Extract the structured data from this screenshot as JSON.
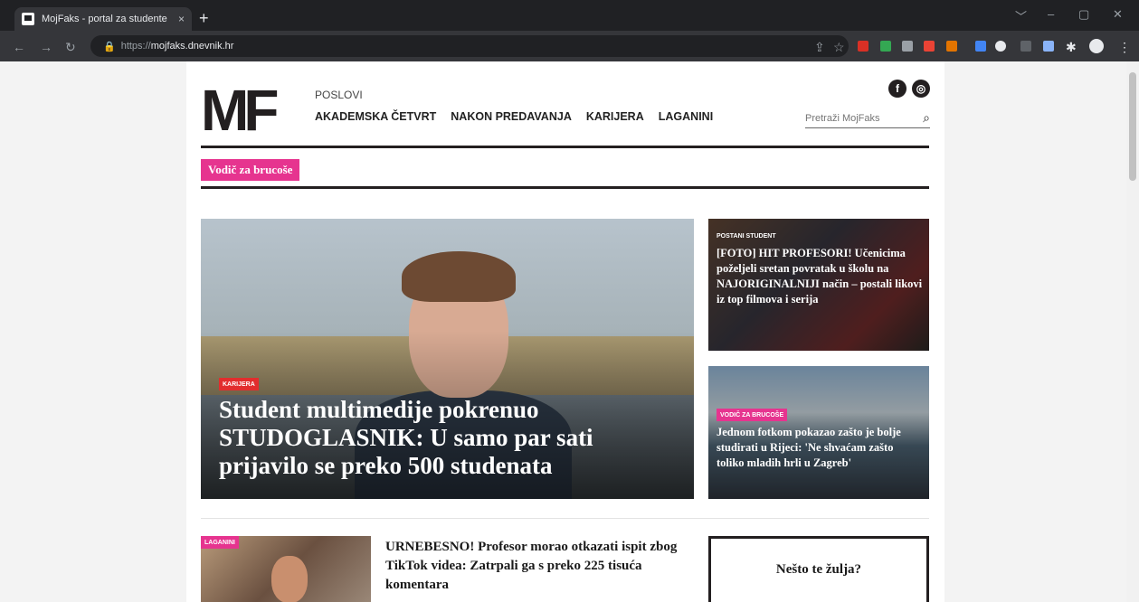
{
  "browser": {
    "tab_title": "MojFaks - portal za studente",
    "tab_close": "×",
    "new_tab": "+",
    "url_scheme": "https://",
    "url_host": "mojfaks.dnevnik.hr",
    "window_controls": [
      "﹀",
      "–",
      "▢",
      "✕"
    ]
  },
  "site": {
    "logo": "MF",
    "nav_top": "POSLOVI",
    "nav_main": [
      "AKADEMSKA ČETVRT",
      "NAKON PREDAVANJA",
      "KARIJERA",
      "LAGANINI"
    ],
    "social": [
      "f",
      "◎"
    ],
    "search_placeholder": "Pretraži MojFaks",
    "pill": "Vodič za brucoše"
  },
  "hero": {
    "tag": "KARIJERA",
    "title": "Student multimedije pokrenuo STUDOGLASNIK: U samo par sati prijavilo se preko 500 studenata"
  },
  "side_cards": [
    {
      "tag": "POSTANI STUDENT",
      "title": "[FOTO] HIT PROFESORI! Učenicima poželjeli sretan povratak u školu na NAJORIGINALNIJI način – postali likovi iz top filmova i serija"
    },
    {
      "tag": "VODIČ ZA BRUCOŠE",
      "title": "Jednom fotkom pokazao zašto je bolje studirati u Rijeci: 'Ne shvaćam zašto toliko mladih hrli u Zagreb'"
    }
  ],
  "article": {
    "tag": "LAGANINI",
    "title": "URNEBESNO! Profesor morao otkazati ispit zbog TikTok videa: Zatrpali ga s preko 225 tisuća komentara"
  },
  "promo_box": {
    "title": "Nešto te žulja?"
  },
  "colors": {
    "accent_pink": "#e6348f",
    "tag_red": "#e22d2d",
    "dark": "#231f20"
  }
}
